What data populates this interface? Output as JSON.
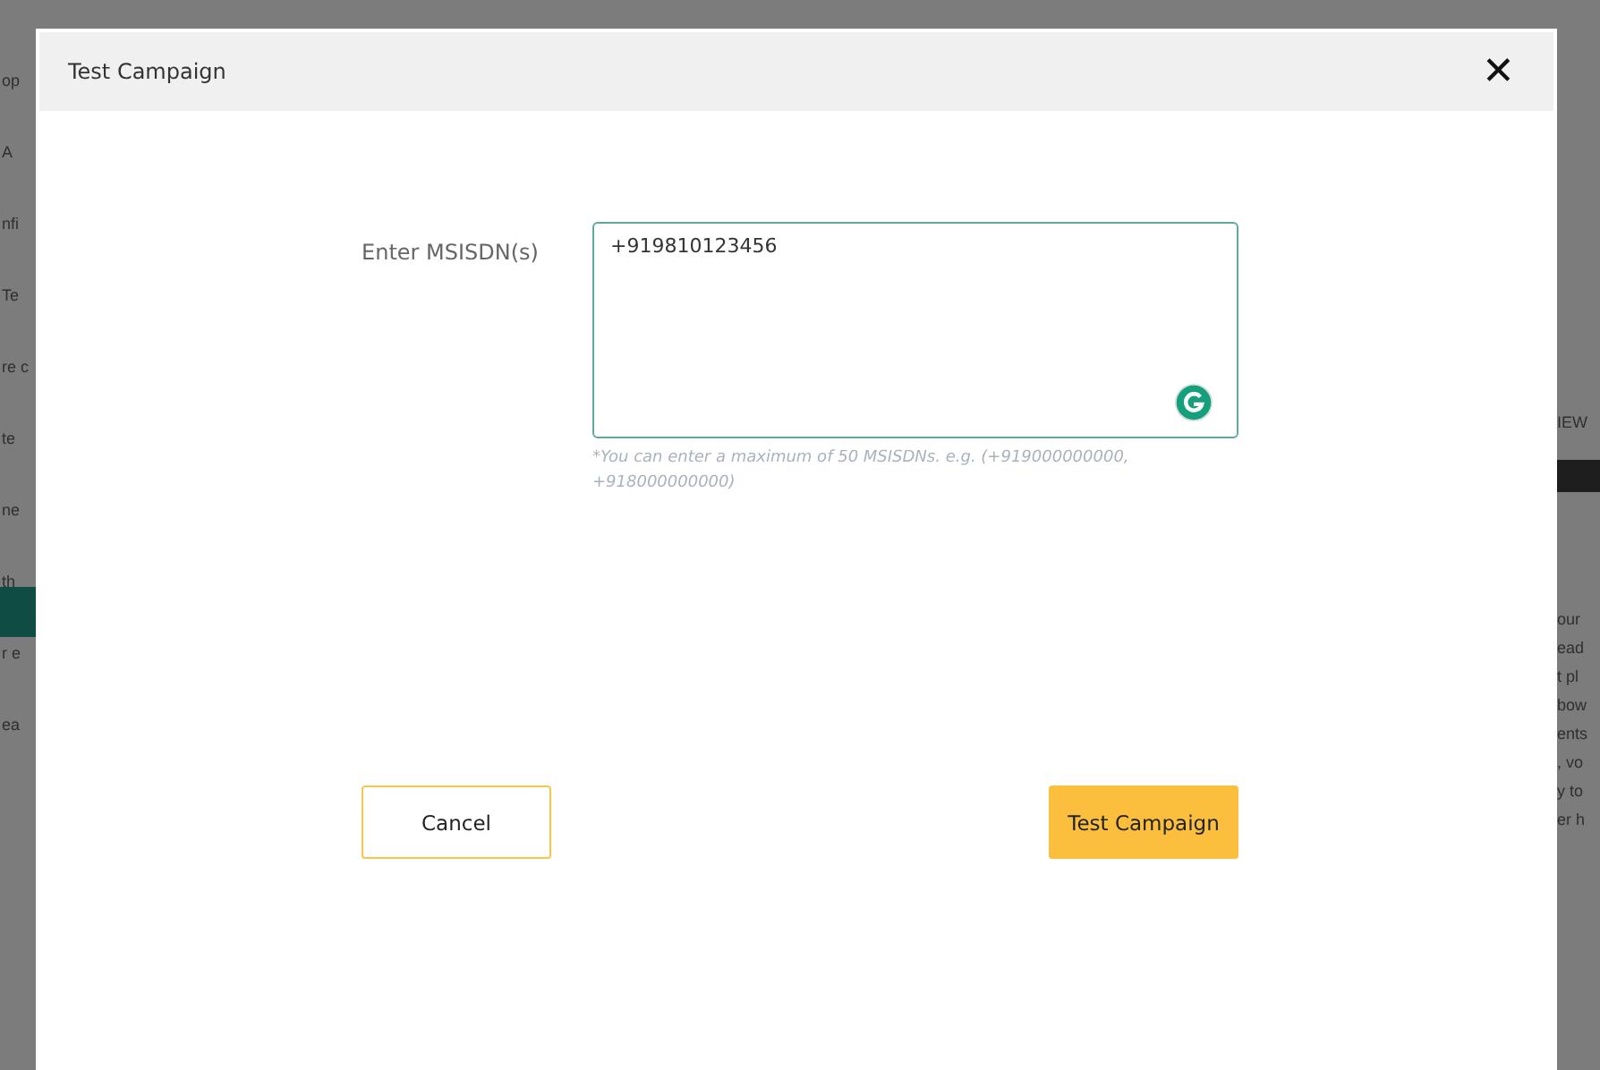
{
  "backdrop": {
    "left": [
      "op",
      "A",
      "nfi",
      "Te",
      "re c",
      "te",
      "ne",
      "th",
      "r e",
      "ea"
    ],
    "right": [
      "IEW",
      "our",
      "ead",
      "t pl",
      "bow",
      "ents",
      ", vo",
      "y to",
      "er h"
    ]
  },
  "modal": {
    "title": "Test Campaign",
    "close": "✕",
    "field": {
      "label": "Enter MSISDN(s)",
      "value": "+919810123456",
      "hint": "*You can enter a maximum of 50 MSISDNs. e.g. (+919000000000, +918000000000)"
    },
    "buttons": [
      {
        "label": "Cancel",
        "kind": "secondary"
      },
      {
        "label": "Test Campaign",
        "kind": "primary"
      }
    ]
  }
}
